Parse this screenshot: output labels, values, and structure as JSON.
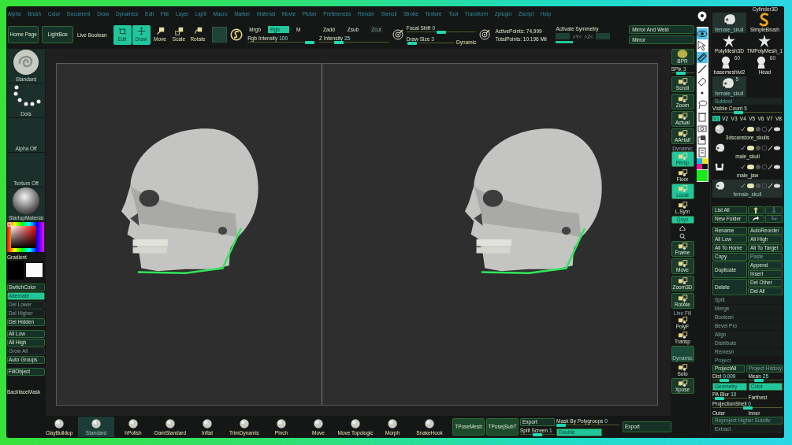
{
  "menu": [
    "Alpha",
    "Brush",
    "Color",
    "Document",
    "Draw",
    "Dynamics",
    "Edit",
    "File",
    "Layer",
    "Light",
    "Macro",
    "Marker",
    "Material",
    "Movie",
    "Picker",
    "Preferences",
    "Render",
    "Stencil",
    "Stroke",
    "Texture",
    "Tool",
    "Transform",
    "Zplugin",
    "Zscript",
    "Help"
  ],
  "top_shelf": {
    "nav": [
      "Home Page",
      "LightBox"
    ],
    "live_boolean": "Live Boolean",
    "transform": [
      {
        "label": "Edit",
        "kind": "edit",
        "selected": true
      },
      {
        "label": "Draw",
        "kind": "draw",
        "selected": true
      },
      {
        "label": "Move",
        "kind": "move",
        "selected": false
      },
      {
        "label": "Scale",
        "kind": "scale",
        "selected": false
      },
      {
        "label": "Rotate",
        "kind": "rotate",
        "selected": false
      }
    ],
    "color_modes": [
      {
        "label": "Mrgb",
        "selected": false
      },
      {
        "label": "Rgb",
        "selected": true
      },
      {
        "label": "M",
        "selected": false
      }
    ],
    "rgb_intensity": {
      "label": "Rgb Intensity",
      "value": "100",
      "level": 1
    },
    "z_modes": [
      {
        "label": "Zadd",
        "disabled": false
      },
      {
        "label": "Zsub",
        "disabled": false
      },
      {
        "label": "Zcut",
        "disabled": true
      }
    ],
    "z_intensity": {
      "label": "Z Intensity",
      "value": "25",
      "level": 0.25
    },
    "focal_shift": {
      "label": "Focal Shift",
      "value": "0",
      "level": 0.5
    },
    "draw_size": {
      "label": "Draw Size",
      "value": "3",
      "level": 0.03
    },
    "dynamic": "Dynamic",
    "stats": [
      "ActivePoints: 74,999",
      "TotalPoints: 10.196 Mil"
    ],
    "symmetry": {
      "label": "Activate Symmetry",
      "on": true,
      "boxes": [
        {
          "selected": false
        },
        {
          "selected": false
        }
      ],
      "axes": [
        ">Y<",
        ">Z<"
      ]
    },
    "mirror": [
      "Mirror And Weld",
      "Mirror"
    ]
  },
  "left_shelf": {
    "thumbs": [
      {
        "kind": "brush",
        "label": "Standard"
      },
      {
        "kind": "stroke",
        "label": "Dots"
      },
      {
        "kind": "alpha",
        "label": "Alpha Off"
      },
      {
        "kind": "texture",
        "label": "Texture Off"
      },
      {
        "kind": "material",
        "label": "StartupMaterial"
      }
    ],
    "gradient": "Gradient",
    "button_groups": [
      [
        {
          "label": "SwitchColor",
          "selected": false,
          "disabled": false
        },
        {
          "label": "Alternate",
          "selected": true,
          "disabled": false
        },
        {
          "label": "Del Lower",
          "selected": false,
          "disabled": true
        },
        {
          "label": "Del Higher",
          "selected": false,
          "disabled": true
        },
        {
          "label": "Del Hidden",
          "selected": false,
          "disabled": false
        }
      ],
      [
        {
          "label": "All Low",
          "selected": false,
          "disabled": false
        },
        {
          "label": "All High",
          "selected": false,
          "disabled": false
        },
        {
          "label": "Grow All",
          "selected": false,
          "disabled": true
        },
        {
          "label": "Auto Groups",
          "selected": false,
          "disabled": false
        }
      ],
      [
        {
          "label": "FillObject",
          "selected": false,
          "disabled": false
        }
      ]
    ],
    "backface_mask": "BackfaceMask"
  },
  "viewports": [
    {
      "kind": "skull"
    },
    {
      "kind": "skull"
    }
  ],
  "right_shelf": {
    "bpr": "BPR",
    "spix": {
      "label": "SPix",
      "value": "3",
      "level": 0.4
    },
    "buttons": [
      {
        "label": "Scroll",
        "kind": "tile",
        "selected": false
      },
      {
        "label": "Zoom",
        "kind": "tile",
        "selected": false
      },
      {
        "label": "Actual",
        "kind": "tile",
        "selected": false
      },
      {
        "label": "AAHalf",
        "kind": "tile",
        "selected": false
      },
      {
        "label": "Persp",
        "caption": "Dynamic",
        "kind": "tile",
        "selected": true
      },
      {
        "label": "Floor",
        "kind": "plain",
        "selected": false
      },
      {
        "label": "Local",
        "kind": "tile",
        "selected": true
      },
      {
        "label": "L.Sym",
        "kind": "plain",
        "selected": false
      },
      {
        "label": "Qxyz",
        "kind": "small",
        "selected": true
      },
      {
        "kind": "icons"
      },
      {
        "label": "Frame",
        "kind": "tile",
        "selected": false
      },
      {
        "label": "Move",
        "kind": "tile",
        "selected": false
      },
      {
        "label": "Zoom3D",
        "kind": "tile",
        "selected": false
      },
      {
        "label": "RotAte",
        "kind": "tile",
        "selected": false
      },
      {
        "label": "PolyF",
        "caption": "Line Fill",
        "kind": "plain",
        "selected": false
      },
      {
        "label": "Transp",
        "kind": "plain",
        "selected": false
      },
      {
        "label": "Dynamic",
        "kind": "blank",
        "selected": false
      },
      {
        "label": "Solo",
        "kind": "plain",
        "selected": false
      },
      {
        "label": "Xpose",
        "kind": "tile",
        "selected": false
      }
    ]
  },
  "tool_strip": [
    {
      "kind": "light"
    },
    {
      "kind": "eye",
      "selected": true
    },
    {
      "kind": "cursor",
      "selected": false
    },
    {
      "kind": "brush",
      "selected": true
    },
    {
      "kind": "pen",
      "selected": false
    },
    {
      "kind": "eraser",
      "selected": false
    },
    {
      "kind": "dot",
      "selected": false
    },
    {
      "kind": "lasso",
      "selected": false
    },
    {
      "kind": "trash",
      "selected": false
    },
    {
      "kind": "camera",
      "selected": false
    },
    {
      "kind": "paste",
      "selected": false
    },
    {
      "kind": "clipboard",
      "selected": false
    },
    {
      "kind": "swatches"
    },
    {
      "kind": "green"
    }
  ],
  "tool_panel": {
    "caption": "Cylinder3D",
    "tools": [
      {
        "label": "female_skull",
        "kind": "skull",
        "selected": true
      },
      {
        "label": "SimpleBrush",
        "kind": "s",
        "selected": false
      },
      {
        "label": "PolyMesh3D",
        "kind": "star",
        "selected": false
      },
      {
        "label": "TMPolyMesh_1",
        "kind": "star",
        "selected": false
      },
      {
        "label": "basemeshlvl2",
        "kind": "head",
        "count": "60",
        "selected": false
      },
      {
        "label": "Head",
        "kind": "head",
        "count": "60",
        "selected": false
      },
      {
        "label": "female_skull",
        "kind": "skull",
        "count": "5",
        "selected": true
      }
    ],
    "subtool": {
      "title": "Subtool",
      "visible_count": {
        "label": "Visible Count",
        "value": "5",
        "level": 0.35
      },
      "versions": [
        {
          "label": "V1",
          "selected": true
        },
        {
          "label": "V2",
          "selected": false
        },
        {
          "label": "V3",
          "selected": false
        },
        {
          "label": "V4",
          "selected": false
        },
        {
          "label": "V5",
          "selected": false
        },
        {
          "label": "V6",
          "selected": false
        },
        {
          "label": "V7",
          "selected": false
        },
        {
          "label": "V8",
          "selected": false
        }
      ],
      "items": [
        {
          "name": "3dscanstore_skulls",
          "kind": "sphere",
          "selected": false
        },
        {
          "name": "male_skull",
          "kind": "skull",
          "selected": false
        },
        {
          "name": "male_jaw",
          "kind": "jaw",
          "selected": false
        },
        {
          "name": "female_skull",
          "kind": "skull",
          "selected": true
        }
      ]
    },
    "list_controls": [
      {
        "kind": "text",
        "label": "List All",
        "disabled": false
      },
      {
        "kind": "up",
        "disabled": false
      },
      {
        "kind": "down",
        "disabled": true
      },
      {
        "kind": "text",
        "label": "New Folder",
        "disabled": false
      },
      {
        "kind": "folder",
        "disabled": false
      },
      {
        "kind": "unfolder",
        "disabled": true
      }
    ],
    "actions": [
      {
        "label": "Rename",
        "tall": false,
        "disabled": false
      },
      {
        "label": "All Low",
        "tall": false,
        "disabled": false
      },
      {
        "label": "All To Home",
        "tall": false,
        "disabled": false
      },
      {
        "label": "Copy",
        "tall": false,
        "disabled": false
      },
      {
        "label": "Duplicate",
        "tall": true,
        "disabled": false
      },
      {
        "label": "Delete",
        "tall": true,
        "disabled": false
      },
      {
        "label": "AutoReorder",
        "tall": false,
        "disabled": false
      },
      {
        "label": "All High",
        "tall": false,
        "disabled": false
      },
      {
        "label": "All To Target",
        "tall": false,
        "disabled": false
      },
      {
        "label": "Paste",
        "tall": false,
        "disabled": true
      },
      {
        "label": "Append",
        "tall": false,
        "disabled": false
      },
      {
        "label": "Insert",
        "tall": false,
        "disabled": false
      },
      {
        "label": "Del Other",
        "tall": false,
        "disabled": false
      },
      {
        "label": "Del All",
        "tall": false,
        "disabled": false
      }
    ],
    "geometry": [
      "Split",
      "Merge",
      "Boolean",
      "Bevel Pro",
      "Align",
      "Distribute",
      "Remesh"
    ],
    "project": {
      "title": "Project",
      "buttons": [
        {
          "label": "ProjectAll",
          "disabled": false
        },
        {
          "label": "Project History",
          "disabled": true
        }
      ],
      "dist": {
        "label": "Dist",
        "value": "0.009",
        "level": 0.3
      },
      "mean": {
        "label": "Mean",
        "value": "25",
        "level": 0.25
      },
      "targets": [
        {
          "label": "Geometry",
          "selected": true
        },
        {
          "label": "Color",
          "selected": true
        }
      ],
      "pa_blur": {
        "label": "PA Blur",
        "value": "10",
        "level": 0.1
      },
      "farthest": "Farthest",
      "projection_shell": {
        "label": "ProjectionShell",
        "value": "0",
        "level": 0.5
      },
      "sides": [
        "Outer",
        "Inner"
      ],
      "reproject": {
        "label": "Reproject Higher Subdiv",
        "disabled": true
      }
    },
    "extract": "Extract"
  },
  "bottom_shelf": {
    "brushes": [
      {
        "label": "ClayBuildup",
        "selected": false
      },
      {
        "label": "Standard",
        "selected": true
      },
      {
        "label": "hPolish",
        "selected": false
      },
      {
        "label": "DamStandard",
        "selected": false
      },
      {
        "label": "Inflat",
        "selected": false
      },
      {
        "label": "TrimDynamic",
        "selected": false
      },
      {
        "label": "Pinch",
        "selected": false
      },
      {
        "label": "Move",
        "selected": false
      },
      {
        "label": "Move Topologic",
        "selected": false
      },
      {
        "label": "Morph",
        "selected": false
      },
      {
        "label": "SnakeHook",
        "selected": false
      }
    ],
    "tpose": [
      "TPoseMesh",
      "TPose|SubT"
    ],
    "export": "Export",
    "split_screen": {
      "label": "Split Screen",
      "value": "1",
      "level": 0.5
    },
    "mask_by_polygroups": {
      "label": "Mask By Polygroups",
      "value": "0",
      "level": 0
    },
    "double": {
      "label": "Double",
      "selected": true
    },
    "export_2": "Export"
  }
}
